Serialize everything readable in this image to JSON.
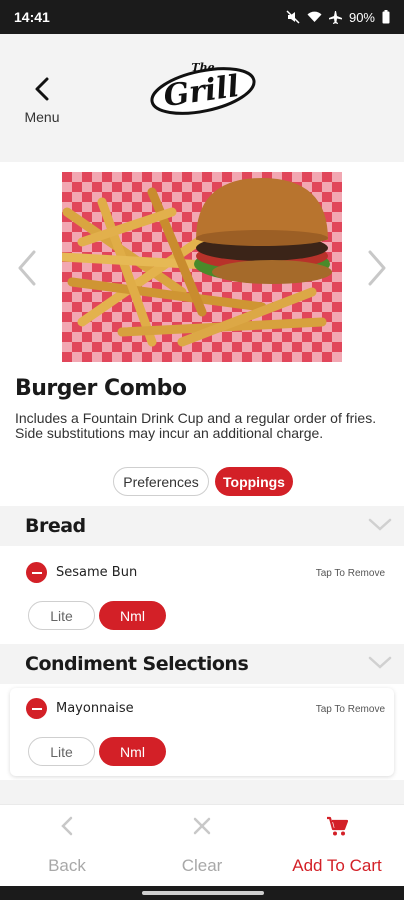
{
  "status_bar": {
    "time": "14:41",
    "battery": "90%"
  },
  "header": {
    "back_label": "Menu",
    "logo_top": "The",
    "logo_main": "Grill"
  },
  "item": {
    "title": "Burger Combo",
    "description": "Includes a Fountain Drink Cup and a regular order of fries.  Side substitutions may incur an additional charge."
  },
  "tabs": [
    {
      "label": "Preferences",
      "active": false
    },
    {
      "label": "Toppings",
      "active": true
    }
  ],
  "sections": [
    {
      "title": "Bread",
      "option": {
        "name": "Sesame Bun",
        "remove_hint": "Tap To Remove",
        "qty_options": [
          "Lite",
          "Nml"
        ],
        "selected": "Nml"
      }
    },
    {
      "title": "Condiment Selections",
      "option": {
        "name": "Mayonnaise",
        "remove_hint": "Tap To Remove",
        "qty_options": [
          "Lite",
          "Nml"
        ],
        "selected": "Nml"
      }
    }
  ],
  "bottom_bar": {
    "back": "Back",
    "clear": "Clear",
    "add_to_cart": "Add To Cart"
  },
  "colors": {
    "accent": "#d32027",
    "section_bg": "#f3f3f3",
    "muted": "#bdbdbd"
  }
}
